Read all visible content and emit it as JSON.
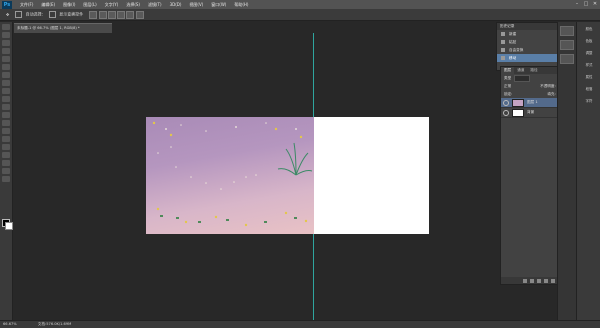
{
  "app": {
    "logo": "Ps"
  },
  "menu": [
    "文件(F)",
    "编辑(E)",
    "图像(I)",
    "图层(L)",
    "文字(Y)",
    "选择(S)",
    "滤镜(T)",
    "3D(D)",
    "视图(V)",
    "窗口(W)",
    "帮助(H)"
  ],
  "window_controls": [
    "–",
    "□",
    "✕"
  ],
  "options": {
    "auto_select_label": "自动选择:",
    "show_transform_label": "显示变换控件"
  },
  "document": {
    "tab_title": "未标题-1 @ 66.7% (图层 1, RGB/8) *"
  },
  "history": {
    "title": "历史记录",
    "items": [
      "新建",
      "粘贴",
      "自由变换",
      "移动"
    ]
  },
  "layers": {
    "tabs": [
      "图层",
      "通道",
      "路径"
    ],
    "kind_label": "类型",
    "blend_mode": "正常",
    "opacity_label": "不透明度:",
    "opacity_value": "100%",
    "lock_label": "锁定:",
    "fill_label": "填充:",
    "fill_value": "100%",
    "items": [
      {
        "name": "图层 1",
        "active": true
      },
      {
        "name": "背景",
        "active": false
      }
    ]
  },
  "side_strip": [
    "颜色",
    "色板",
    "调整",
    "样式",
    "属性",
    "段落",
    "字符"
  ],
  "status": {
    "zoom": "66.67%",
    "doc_info": "文档:576.0K/1.69M"
  },
  "colors": {
    "foreground": "#000000",
    "background": "#ffffff",
    "guide": "#2fa59e",
    "history_highlight": "#5a7fa8",
    "layer_highlight": "#536a8b"
  }
}
